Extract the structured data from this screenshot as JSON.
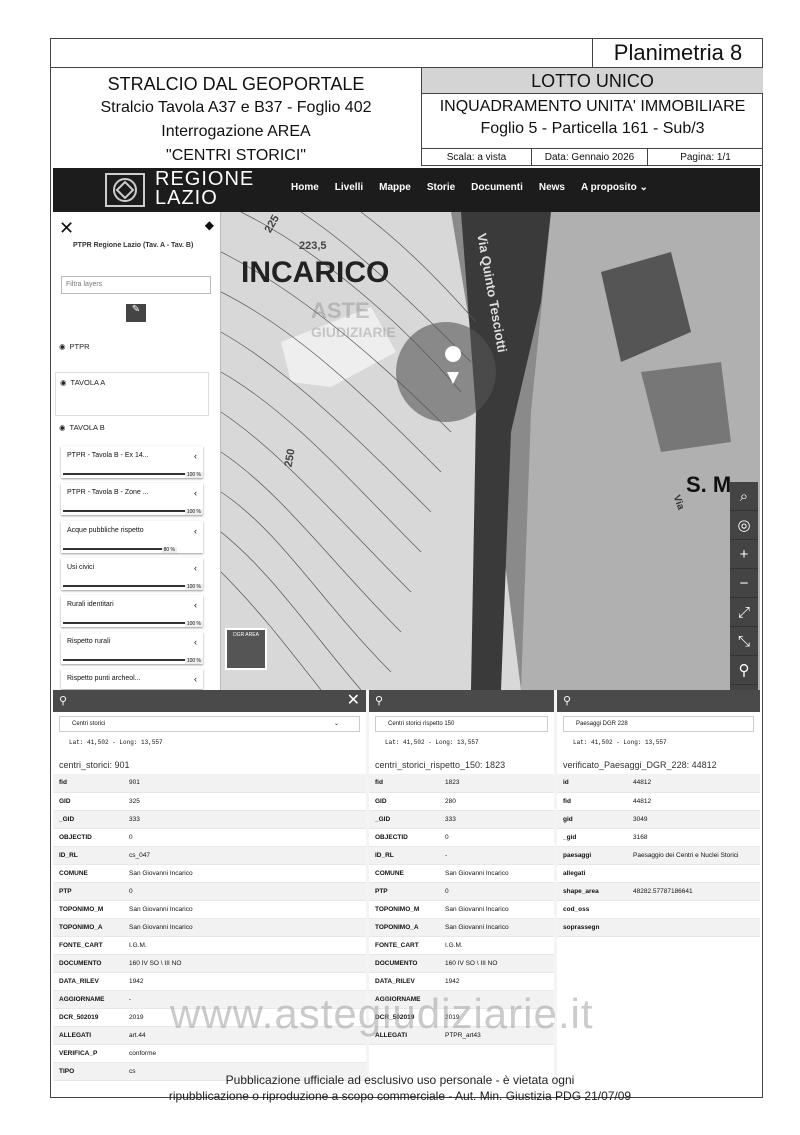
{
  "header": {
    "plan_title": "Planimetria 8",
    "left_line1": "STRALCIO DAL GEOPORTALE",
    "left_line2": "Stralcio Tavola A37 e B37 - Foglio 402",
    "left_line3": "Interrogazione AREA",
    "left_line4": "\"CENTRI STORICI\"",
    "lotto": "LOTTO UNICO",
    "inq_line1": "INQUADRAMENTO UNITA' IMMOBILIARE",
    "inq_line2": "Foglio 5 - Particella 161 - Sub/3",
    "scala": "Scala: a vista",
    "data": "Data: Gennaio 2026",
    "pagina": "Pagina: 1/1"
  },
  "navbar": {
    "logo_line1": "REGIONE",
    "logo_line2": "LAZIO",
    "menu": [
      "Home",
      "Livelli",
      "Mappe",
      "Storie",
      "Documenti",
      "News",
      "A proposito"
    ]
  },
  "sidebar": {
    "title": "PTPR Regione Lazio (Tav. A - Tav. B)",
    "filter_placeholder": "Filtra layers",
    "groups": [
      "PTPR",
      "TAVOLA A",
      "TAVOLA B"
    ],
    "layers": [
      {
        "name": "PTPR - Tavola B - Ex 14...",
        "pct": "100 %"
      },
      {
        "name": "PTPR - Tavola B - Zone ...",
        "pct": "100 %"
      },
      {
        "name": "Acque pubbliche rispetto",
        "pct": "80 %"
      },
      {
        "name": "Usi civici",
        "pct": "100 %"
      },
      {
        "name": "Rurali identitari",
        "pct": "100 %"
      },
      {
        "name": "Rispetto rurali",
        "pct": "100 %"
      },
      {
        "name": "Rispetto punti archeol...",
        "pct": ""
      }
    ]
  },
  "map": {
    "label_incarico": "INCARICO",
    "label_via": "Via Quinto Tesciotti",
    "label_225": "225",
    "label_2235": "223,5",
    "label_250": "250",
    "label_sm": "S. M",
    "label_via2": "Via",
    "minimap_label": "DGR AREA",
    "tools": [
      "search-zoom",
      "locate",
      "zoom-in",
      "zoom-out",
      "fullscreen",
      "expand",
      "marker",
      "more"
    ]
  },
  "panels": [
    {
      "select": "Centri storici",
      "coord": "Lat: 41,502 - Long: 13,557",
      "title": "centri_storici: 901",
      "rows": [
        [
          "fid",
          "901"
        ],
        [
          "GID",
          "325"
        ],
        [
          "_GID",
          "333"
        ],
        [
          "OBJECTID",
          "0"
        ],
        [
          "ID_RL",
          "cs_047"
        ],
        [
          "COMUNE",
          "San Giovanni Incarico"
        ],
        [
          "PTP",
          "0"
        ],
        [
          "TOPONIMO_M",
          "San Giovanni Incarico"
        ],
        [
          "TOPONIMO_A",
          "San Giovanni Incarico"
        ],
        [
          "FONTE_CART",
          "I.G.M."
        ],
        [
          "DOCUMENTO",
          "160 IV SO \\ III NO"
        ],
        [
          "DATA_RILEV",
          "1942"
        ],
        [
          "AGGIORNAME",
          "-"
        ],
        [
          "DCR_502019",
          "2019"
        ],
        [
          "ALLEGATI",
          "art.44"
        ],
        [
          "VERIFICA_P",
          "conforme"
        ],
        [
          "TIPO",
          "cs"
        ]
      ]
    },
    {
      "select": "Centri storici rispetto 150",
      "coord": "Lat: 41,502 - Long: 13,557",
      "title": "centri_storici_rispetto_150: 1823",
      "rows": [
        [
          "fid",
          "1823"
        ],
        [
          "GID",
          "280"
        ],
        [
          "_GID",
          "333"
        ],
        [
          "OBJECTID",
          "0"
        ],
        [
          "ID_RL",
          "-"
        ],
        [
          "COMUNE",
          "San Giovanni Incarico"
        ],
        [
          "PTP",
          "0"
        ],
        [
          "TOPONIMO_M",
          "San Giovanni Incarico"
        ],
        [
          "TOPONIMO_A",
          "San Giovanni Incarico"
        ],
        [
          "FONTE_CART",
          "I.G.M."
        ],
        [
          "DOCUMENTO",
          "160 IV SO \\ III NO"
        ],
        [
          "DATA_RILEV",
          "1942"
        ],
        [
          "AGGIORNAME",
          ""
        ],
        [
          "DCR_502019",
          "2019"
        ],
        [
          "ALLEGATI",
          "PTPR_art43"
        ]
      ]
    },
    {
      "select": "Paesaggi DGR 228",
      "coord": "Lat: 41,502 - Long: 13,557",
      "title": "verificato_Paesaggi_DGR_228: 44812",
      "rows": [
        [
          "id",
          "44812"
        ],
        [
          "fid",
          "44812"
        ],
        [
          "gid",
          "3049"
        ],
        [
          "_gid",
          "3168"
        ],
        [
          "paesaggi",
          "Paesaggio dei Centri e Nuclei Storici"
        ],
        [
          "allegati",
          ""
        ],
        [
          "shape_area",
          "48282.57787186641"
        ],
        [
          "cod_oss",
          ""
        ],
        [
          "soprassegn",
          ""
        ]
      ]
    }
  ],
  "watermark": {
    "small1": "ASTE",
    "small2": "GIUDIZIARIE",
    "big": "www.astegiudiziarie.it"
  },
  "footer": {
    "line1": "Pubblicazione ufficiale ad esclusivo uso personale - è vietata ogni",
    "line2": "ripubblicazione o riproduzione a scopo commerciale - Aut. Min. Giustizia PDG 21/07/09"
  }
}
